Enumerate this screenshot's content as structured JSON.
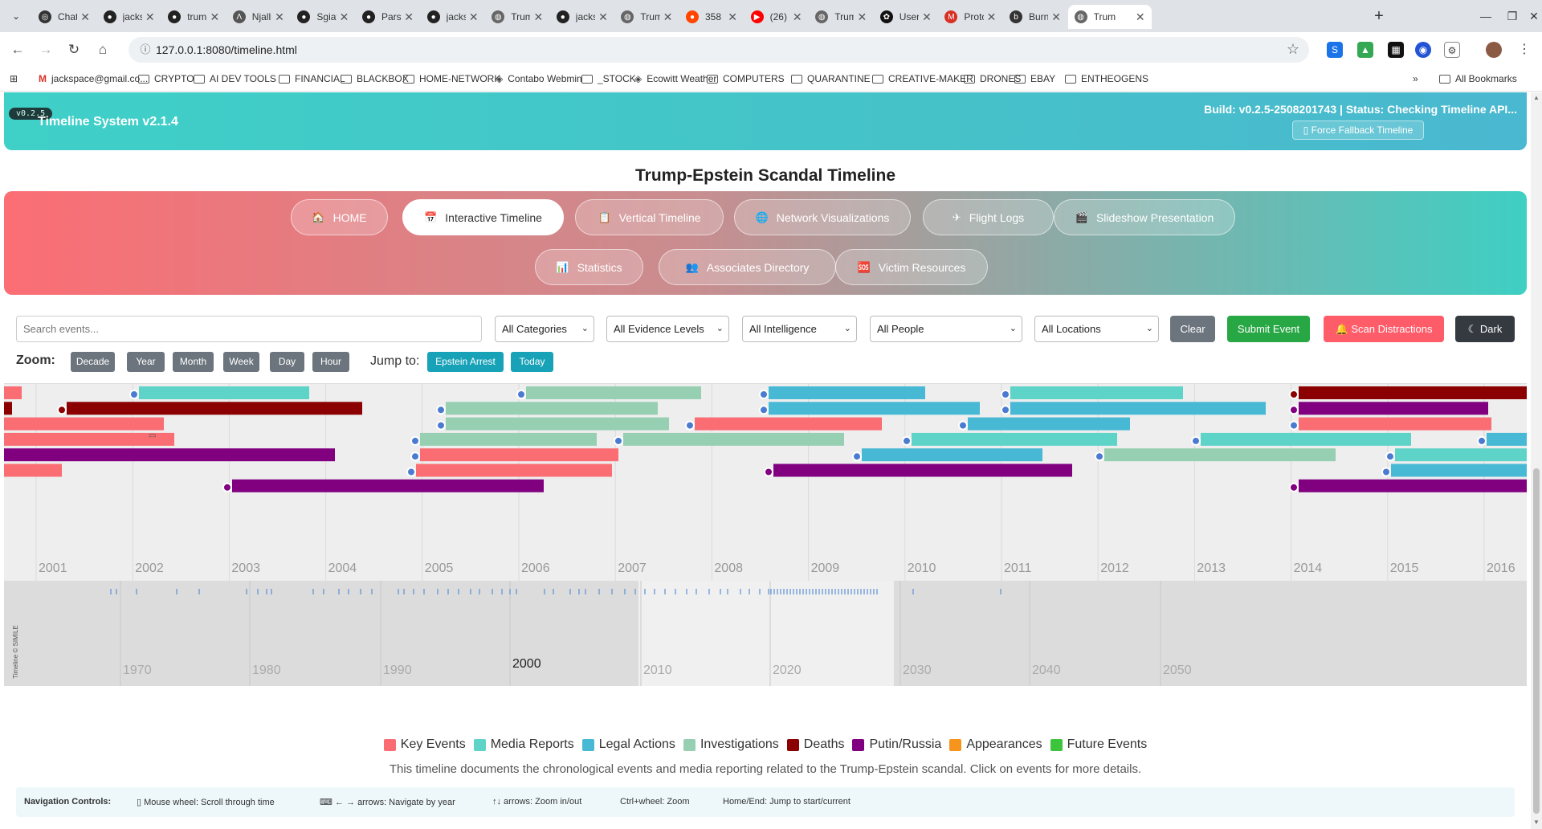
{
  "browser": {
    "tabs": [
      {
        "label": "Chat",
        "icon": "chat-icon"
      },
      {
        "label": "jacks",
        "icon": "github-icon"
      },
      {
        "label": "trum",
        "icon": "github-icon"
      },
      {
        "label": "Njalli",
        "icon": "lambda-icon"
      },
      {
        "label": "Sgiat",
        "icon": "github-icon"
      },
      {
        "label": "Parse",
        "icon": "github-icon"
      },
      {
        "label": "jacks",
        "icon": "github-icon"
      },
      {
        "label": "Trum",
        "icon": "globe-icon"
      },
      {
        "label": "jacks",
        "icon": "github-icon"
      },
      {
        "label": "Trum",
        "icon": "globe-icon"
      },
      {
        "label": "358",
        "icon": "reddit-icon"
      },
      {
        "label": "(26)",
        "icon": "youtube-icon"
      },
      {
        "label": "Trum",
        "icon": "globe-icon"
      },
      {
        "label": "User",
        "icon": "openai-icon"
      },
      {
        "label": "Proto",
        "icon": "gmail-icon"
      },
      {
        "label": "Burn",
        "icon": "bm-icon"
      },
      {
        "label": "Trum",
        "icon": "globe-icon"
      }
    ],
    "url": "127.0.0.1:8080/timeline.html",
    "bookmarks": [
      {
        "label": "jackspace@gmail.co...",
        "type": "gmail"
      },
      {
        "label": "CRYPTO",
        "type": "folder"
      },
      {
        "label": "AI DEV TOOLS",
        "type": "folder"
      },
      {
        "label": "FINANCIAL",
        "type": "folder"
      },
      {
        "label": "BLACKBOX",
        "type": "folder"
      },
      {
        "label": "HOME-NETWORK",
        "type": "folder"
      },
      {
        "label": "Contabo Webmin",
        "type": "site"
      },
      {
        "label": "_STOCK",
        "type": "folder"
      },
      {
        "label": "Ecowitt Weather",
        "type": "site"
      },
      {
        "label": "COMPUTERS",
        "type": "folder"
      },
      {
        "label": "QUARANTINE",
        "type": "folder"
      },
      {
        "label": "CREATIVE-MAKER",
        "type": "folder"
      },
      {
        "label": "DRONES",
        "type": "folder"
      },
      {
        "label": "EBAY",
        "type": "folder"
      },
      {
        "label": "ENTHEOGENS",
        "type": "folder"
      }
    ],
    "more_bookmarks": "»",
    "all_bookmarks": "All Bookmarks"
  },
  "header": {
    "badge": "v0.2.5",
    "title": "Timeline System v2.1.4",
    "build": "Build: v0.2.5-2508201743 | Status: Checking Timeline API...",
    "fallback": "Force Fallback Timeline"
  },
  "page_title": "Trump-Epstein Scandal Timeline",
  "nav": [
    {
      "label": "HOME",
      "icon": "🏠"
    },
    {
      "label": "Interactive Timeline",
      "icon": "📅",
      "active": true
    },
    {
      "label": "Vertical Timeline",
      "icon": "📋"
    },
    {
      "label": "Network Visualizations",
      "icon": "🌐"
    },
    {
      "label": "Flight Logs",
      "icon": "✈"
    },
    {
      "label": "Slideshow Presentation",
      "icon": "🎬"
    },
    {
      "label": "Statistics",
      "icon": "📊"
    },
    {
      "label": "Associates Directory",
      "icon": "👥"
    },
    {
      "label": "Victim Resources",
      "icon": "🆘"
    }
  ],
  "controls": {
    "search_placeholder": "Search events...",
    "filters": [
      "All Categories",
      "All Evidence Levels",
      "All Intelligence",
      "All People",
      "All Locations"
    ],
    "clear": "Clear",
    "submit": "Submit Event",
    "scan": "Scan Distractions",
    "dark": "Dark"
  },
  "zoom": {
    "label": "Zoom:",
    "levels": [
      "Decade",
      "Year",
      "Month",
      "Week",
      "Day",
      "Hour"
    ],
    "jump_label": "Jump to:",
    "jumps": [
      "Epstein Arrest",
      "Today"
    ]
  },
  "timeline": {
    "upper_years": [
      "2001",
      "2002",
      "2003",
      "2004",
      "2005",
      "2006",
      "2007",
      "2008",
      "2009",
      "2010",
      "2011",
      "2012",
      "2013",
      "2014",
      "2015",
      "2016"
    ],
    "lower_years": [
      "1970",
      "1980",
      "1990",
      "2010",
      "2020",
      "2030",
      "2040",
      "2050"
    ],
    "lower_highlight": "2000",
    "watermark": "Timeline © SIMILE",
    "colors": {
      "key": "#f96d73",
      "media": "#5ed3c8",
      "legal": "#47b9d4",
      "investigation": "#97cfb2",
      "death": "#8b0000",
      "putin": "#800080"
    }
  },
  "legend": [
    {
      "label": "Key Events",
      "color": "#f96d73"
    },
    {
      "label": "Media Reports",
      "color": "#5ed3c8"
    },
    {
      "label": "Legal Actions",
      "color": "#47b9d4"
    },
    {
      "label": "Investigations",
      "color": "#97cfb2"
    },
    {
      "label": "Deaths",
      "color": "#8b0000"
    },
    {
      "label": "Putin/Russia",
      "color": "#800080"
    },
    {
      "label": "Appearances",
      "color": "#f7941d"
    },
    {
      "label": "Future Events",
      "color": "#3cc43c"
    }
  ],
  "description": "This timeline documents the chronological events and media reporting related to the Trump-Epstein scandal. Click on events for more details.",
  "nav_controls": {
    "title": "Navigation Controls:",
    "items": [
      "Mouse wheel: Scroll through time",
      "← → arrows: Navigate by year",
      "↑↓ arrows: Zoom in/out",
      "Ctrl+wheel: Zoom",
      "Home/End: Jump to start/current"
    ]
  }
}
